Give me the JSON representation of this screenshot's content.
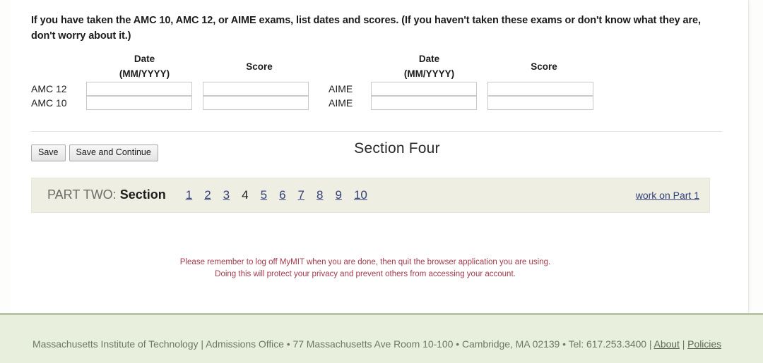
{
  "prompt": {
    "text": "If you have taken the AMC 10, AMC 12, or AIME exams, list dates and scores. (If you haven't taken these exams or don't know what they are, don't worry about it.)"
  },
  "score_table": {
    "headers": {
      "date_main": "Date",
      "date_sub": "(MM/YYYY)",
      "score": "Score",
      "date_main_2": "Date",
      "date_sub_2": "(MM/YYYY)",
      "score_2": "Score"
    },
    "rows": [
      {
        "left_label": "AMC 12",
        "left_date_value": "",
        "left_score_value": "",
        "right_label": "AIME",
        "right_date_value": "",
        "right_score_value": ""
      },
      {
        "left_label": "AMC 10",
        "left_date_value": "",
        "left_score_value": "",
        "right_label": "AIME",
        "right_date_value": "",
        "right_score_value": ""
      }
    ]
  },
  "actions": {
    "save_label": "Save",
    "save_continue_label": "Save and Continue",
    "section_title": "Section Four"
  },
  "part_nav": {
    "lead_prefix": "PART TWO:",
    "lead_word": "Section",
    "sections": [
      {
        "label": "1",
        "current": false
      },
      {
        "label": "2",
        "current": false
      },
      {
        "label": "3",
        "current": false
      },
      {
        "label": "4",
        "current": true
      },
      {
        "label": "5",
        "current": false
      },
      {
        "label": "6",
        "current": false
      },
      {
        "label": "7",
        "current": false
      },
      {
        "label": "8",
        "current": false
      },
      {
        "label": "9",
        "current": false
      },
      {
        "label": "10",
        "current": false
      }
    ],
    "work_on_part_1": "work on Part 1",
    "link_color": "#33407a",
    "bar_color": "#eeeee2"
  },
  "notice": {
    "line1": "Please remember to log off MyMIT when you are done, then quit the browser application you are using.",
    "line2": "Doing this will protect your privacy and prevent others from accessing your account.",
    "color": "#a33a4a"
  },
  "footer": {
    "org": "Massachusetts Institute of Technology",
    "sep1": " | ",
    "office": "Admissions Office",
    "bullet1": " • ",
    "address": "77 Massachusetts Ave Room 10-100",
    "bullet2": " • ",
    "city": "Cambridge, MA 02139",
    "bullet3": " • ",
    "phone": "Tel: 617.253.3400",
    "sep2": " | ",
    "about_label": "About",
    "sep3": " | ",
    "policies_label": "Policies",
    "band_color": "#e8efdd"
  }
}
